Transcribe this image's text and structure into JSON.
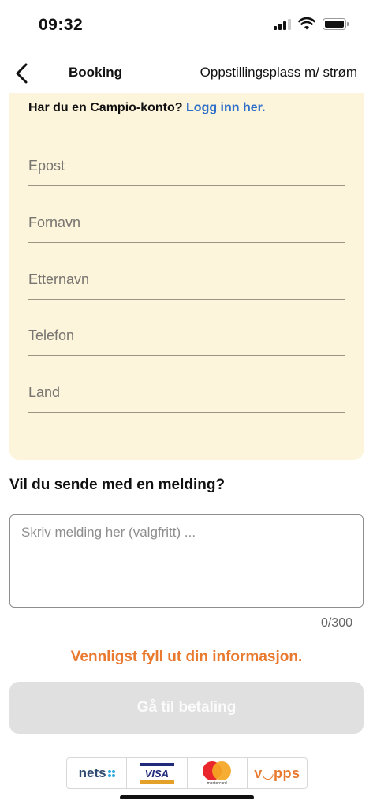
{
  "status_bar": {
    "time": "09:32",
    "icons": [
      "cellular-signal-icon",
      "wifi-icon",
      "battery-icon"
    ]
  },
  "nav": {
    "back_icon": "chevron-left-icon",
    "title": "Booking",
    "subtitle": "Oppstillingsplass m/ strøm"
  },
  "login_prompt": {
    "text": "Har du en Campio-konto?",
    "link_text": "Logg inn her."
  },
  "form": {
    "fields": [
      {
        "placeholder": "Epost",
        "value": ""
      },
      {
        "placeholder": "Fornavn",
        "value": ""
      },
      {
        "placeholder": "Etternavn",
        "value": ""
      },
      {
        "placeholder": "Telefon",
        "value": ""
      },
      {
        "placeholder": "Land",
        "value": ""
      }
    ],
    "card_color": "#fdf4dc"
  },
  "message": {
    "heading": "Vil du sende med en melding?",
    "placeholder": "Skriv melding her (valgfritt) ...",
    "value": "",
    "char_count": "0/300"
  },
  "validation_text": "Vennligst fyll ut din informasjon.",
  "pay_button_label": "Gå til betaling",
  "payment_logos": {
    "nets": "nets",
    "visa": "VISA",
    "mastercard": "mastercard",
    "vipps": "vipps",
    "vipps_display": "v◡pps"
  },
  "colors": {
    "accent": "#e8792e",
    "link": "#2e6fc9",
    "button_disabled": "#e0e0e0"
  }
}
